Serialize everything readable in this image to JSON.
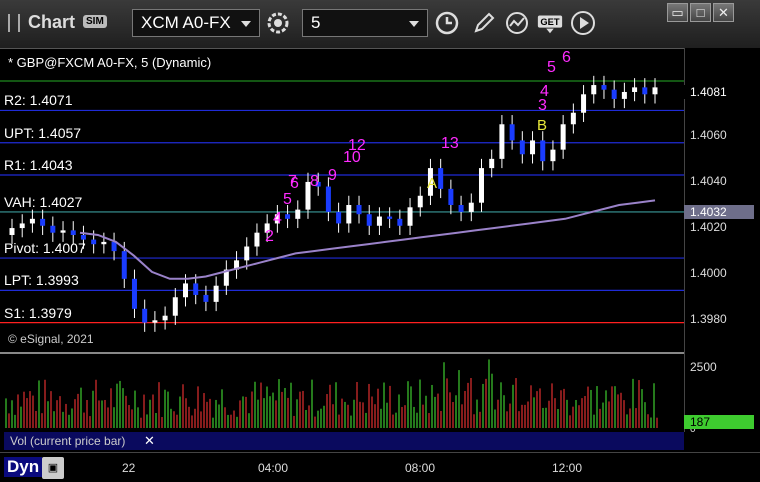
{
  "toolbar": {
    "title": "Chart",
    "sim_badge": "SIM",
    "symbol": "XCM A0-FX",
    "interval": "5",
    "get_label": "GET"
  },
  "symbol_label": "* GBP@FXCM A0-FX, 5 (Dynamic)",
  "copyright": "© eSignal, 2021",
  "levels": [
    {
      "label": "R2: 1.4071",
      "price": 1.4071,
      "color": "#1f2bd6"
    },
    {
      "label": "UPT: 1.4057",
      "price": 1.4057,
      "color": "#1f2bd6"
    },
    {
      "label": "R1: 1.4043",
      "price": 1.4043,
      "color": "#1f2bd6"
    },
    {
      "label": "VAH: 1.4027",
      "price": 1.4027,
      "color": "#3b9a9a"
    },
    {
      "label": "Pivot: 1.4007",
      "price": 1.4007,
      "color": "#1f2bd6"
    },
    {
      "label": "LPT: 1.3993",
      "price": 1.3993,
      "color": "#1f2bd6"
    },
    {
      "label": "S1: 1.3979",
      "price": 1.3979,
      "color": "#ff2020"
    }
  ],
  "price_ticks": [
    "1.4060",
    "1.4040",
    "1.4020",
    "1.4000",
    "1.3980"
  ],
  "price_tags": {
    "last": "1.4081",
    "vwap": "1.4032"
  },
  "volume": {
    "label": "Vol (current price bar)",
    "close_icon": "✕",
    "ticks": [
      "2500",
      "0"
    ],
    "last_tag": "187"
  },
  "time_ticks": [
    "22",
    "04:00",
    "08:00",
    "12:00"
  ],
  "footer": {
    "dyn": "Dyn"
  },
  "annotations": {
    "A": "A",
    "B": "B",
    "counts_magenta": [
      "2",
      "4",
      "5",
      "6",
      "7",
      "8",
      "9",
      "10",
      "12",
      "13",
      "3",
      "4",
      "5",
      "6",
      "7"
    ]
  },
  "chart_data": {
    "type": "candlestick",
    "ylim": [
      1.3968,
      1.4092
    ],
    "close_prices": [
      1.402,
      1.4022,
      1.4024,
      1.4021,
      1.4018,
      1.4019,
      1.4017,
      1.4015,
      1.4013,
      1.4014,
      1.401,
      1.3998,
      1.3985,
      1.3979,
      1.398,
      1.3982,
      1.399,
      1.3996,
      1.3991,
      1.3988,
      1.3995,
      1.4002,
      1.4006,
      1.4012,
      1.4018,
      1.4022,
      1.4026,
      1.4024,
      1.4028,
      1.404,
      1.4038,
      1.4027,
      1.4022,
      1.403,
      1.4026,
      1.4021,
      1.4025,
      1.4024,
      1.4021,
      1.4029,
      1.4034,
      1.4046,
      1.4037,
      1.403,
      1.4027,
      1.4031,
      1.4046,
      1.405,
      1.4065,
      1.4058,
      1.4052,
      1.4058,
      1.4049,
      1.4054,
      1.4065,
      1.407,
      1.4078,
      1.4082,
      1.408,
      1.4076,
      1.4079,
      1.4081,
      1.4078,
      1.4081
    ],
    "vwap": [
      1.4018,
      1.4017,
      1.4014,
      1.4008,
      1.4001,
      1.3998,
      1.3998,
      1.3999,
      1.4001,
      1.4003,
      1.4005,
      1.4007,
      1.4009,
      1.401,
      1.4011,
      1.4012,
      1.4013,
      1.4014,
      1.4015,
      1.4016,
      1.4017,
      1.4018,
      1.4019,
      1.402,
      1.4021,
      1.4022,
      1.4023,
      1.4024,
      1.4026,
      1.4028,
      1.403,
      1.4031,
      1.4032
    ]
  }
}
